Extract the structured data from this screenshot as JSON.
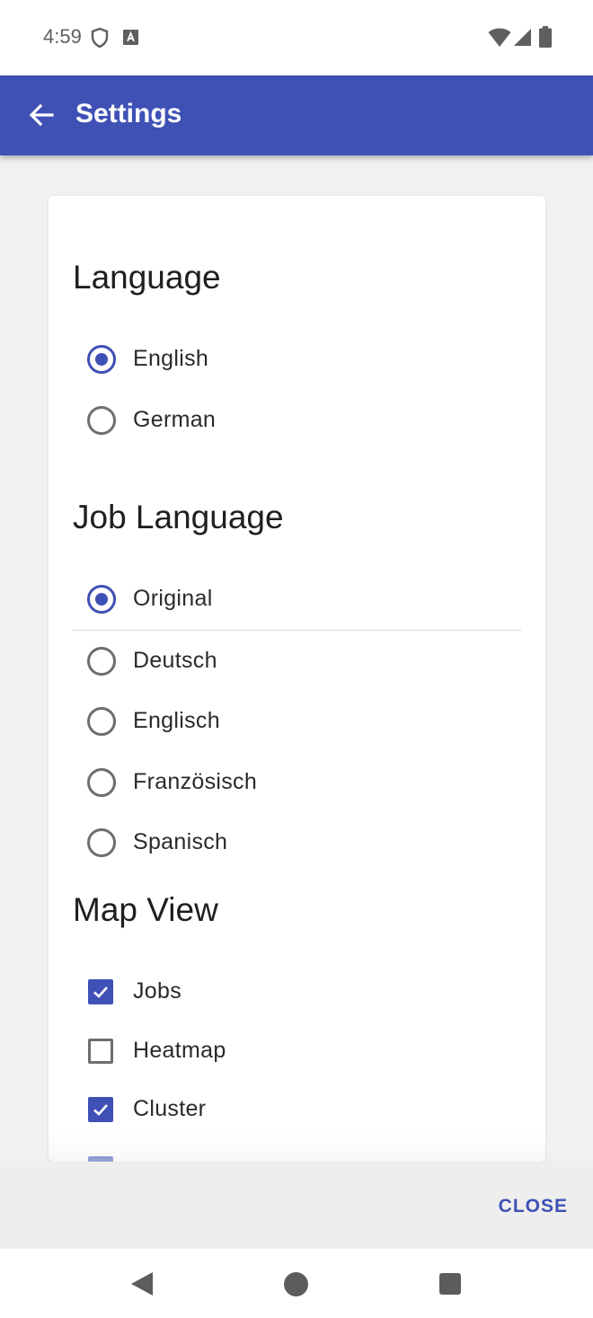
{
  "status_bar": {
    "time": "4:59",
    "icons": [
      "shield-icon",
      "a-badge-icon",
      "wifi-icon",
      "signal-icon",
      "battery-icon"
    ]
  },
  "app_bar": {
    "title": "Settings",
    "back_icon": "arrow-left-icon",
    "background": "#3f51b5"
  },
  "dialog": {
    "sections": {
      "language": {
        "title": "Language",
        "options": [
          {
            "label": "English",
            "selected": true
          },
          {
            "label": "German",
            "selected": false
          }
        ]
      },
      "job_language": {
        "title": "Job Language",
        "options": [
          {
            "label": "Original",
            "selected": true
          },
          {
            "label": "Deutsch",
            "selected": false
          },
          {
            "label": "Englisch",
            "selected": false
          },
          {
            "label": "Französisch",
            "selected": false
          },
          {
            "label": "Spanisch",
            "selected": false
          }
        ]
      },
      "map_view": {
        "title": "Map View",
        "options": [
          {
            "label": "Jobs",
            "checked": true
          },
          {
            "label": "Heatmap",
            "checked": false
          },
          {
            "label": "Cluster",
            "checked": true
          },
          {
            "label": "",
            "checked": true
          }
        ]
      }
    },
    "close_label": "CLOSE"
  },
  "nav_bar": {
    "icons": [
      "back-triangle-icon",
      "home-circle-icon",
      "recents-square-icon"
    ]
  },
  "colors": {
    "accent": "#3f51b5",
    "background": "#f1f1f1"
  }
}
